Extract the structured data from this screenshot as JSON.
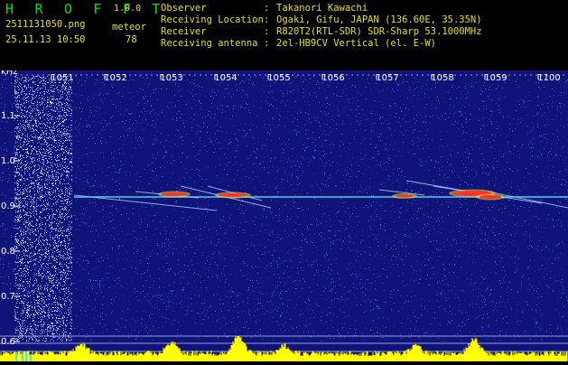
{
  "header": {
    "app_name": "H R O F F T",
    "app_version": "1.0.0",
    "file_name": "2511131050.png",
    "mode": "meteor",
    "datetime": "25.11.13 10:50",
    "count": "78",
    "fields": [
      {
        "label": "Observer",
        "value": "Takanori Kawachi"
      },
      {
        "label": "Receiving Location",
        "value": "Ogaki, Gifu, JAPAN (136.60E, 35.35N)"
      },
      {
        "label": "Receiver",
        "value": "R820T2(RTL-SDR) SDR-Sharp 53.1000MHz"
      },
      {
        "label": "Receiving antenna",
        "value": "2el-HB9CV Vertical (el. E-W)"
      }
    ]
  },
  "chart_data": {
    "type": "heatmap",
    "y_unit_label": "kHz",
    "x_ticks": [
      "1051",
      "1052",
      "1053",
      "1054",
      "1055",
      "1056",
      "1057",
      "1058",
      "1059",
      "1100"
    ],
    "y_ticks": [
      "1.1",
      "1.0",
      "0.9",
      "0.8",
      "0.7",
      "0.6"
    ],
    "ylim": [
      0.58,
      1.17
    ],
    "grid": false,
    "colors": {
      "background": "#14148a",
      "noise": "#3c64e6",
      "carrier": "#46d2e6",
      "meteor_hot": "#ff3030",
      "meteor_warm": "#e6e628",
      "level_bar": "#ffff00",
      "reference_line": "#c8c8ff"
    }
  }
}
